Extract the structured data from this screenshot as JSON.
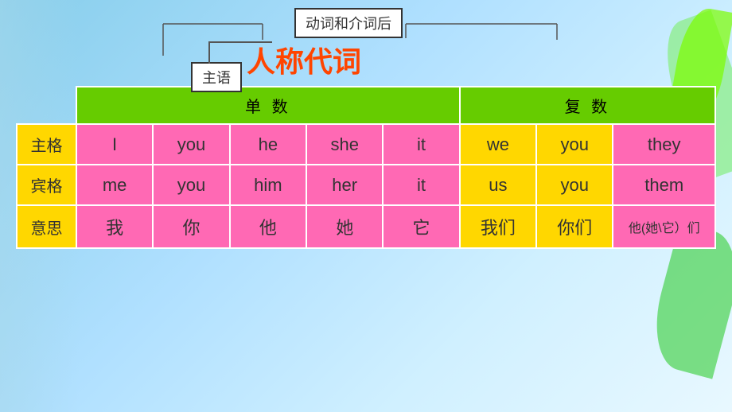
{
  "title": {
    "main": "人称代词",
    "label1": "主语",
    "label2": "动词和介词后"
  },
  "table": {
    "header": {
      "singular": "单 数",
      "plural": "复 数"
    },
    "rows": [
      {
        "label": "主格",
        "cells": [
          "I",
          "you",
          "he",
          "she",
          "it",
          "we",
          "you",
          "they"
        ]
      },
      {
        "label": "宾格",
        "cells": [
          "me",
          "you",
          "him",
          "her",
          "it",
          "us",
          "you",
          "them"
        ]
      },
      {
        "label": "意思",
        "cells": [
          "我",
          "你",
          "他",
          "她",
          "它",
          "我们",
          "你们",
          "他(她\\它）们"
        ]
      }
    ]
  }
}
